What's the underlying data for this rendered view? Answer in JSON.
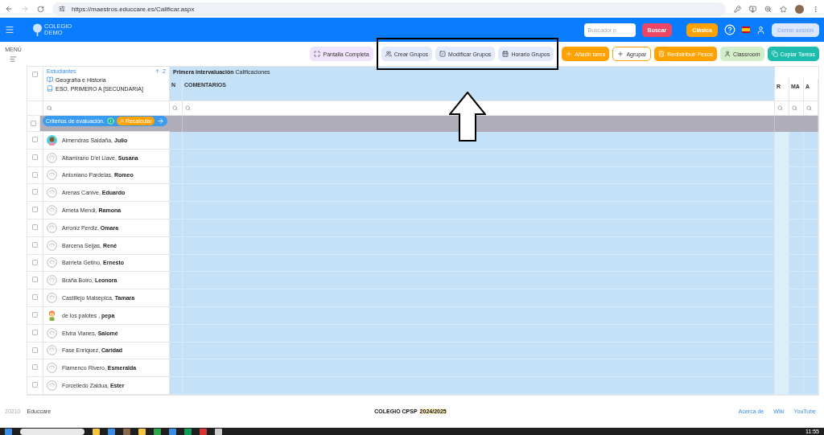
{
  "browser": {
    "url": "https://maestros.educcare.es/Calificar.aspx"
  },
  "header": {
    "logo": [
      "COLEGIO",
      "DEMO"
    ],
    "search_placeholder": "Buscador p",
    "search_button": "Buscar",
    "classic_button": "Clásica",
    "logout_button": "Cerrar sesión"
  },
  "sidebar": {
    "label": "MENÚ"
  },
  "toolbar": [
    {
      "label": "Pantalla Completa",
      "kind": "purple"
    },
    {
      "label": "Crear Grupos",
      "kind": "light"
    },
    {
      "label": "Modificar Grupos",
      "kind": "light"
    },
    {
      "label": "Horario Grupos",
      "kind": "light"
    },
    {
      "label": "Añadir tarea",
      "kind": "orange"
    },
    {
      "label": "Agrupar",
      "kind": "outline"
    },
    {
      "label": "Redistribuir Pesos",
      "kind": "orange"
    },
    {
      "label": "Classroom",
      "kind": "green"
    },
    {
      "label": "Copiar Tareas",
      "kind": "teal"
    }
  ],
  "table": {
    "select_all_checked": false,
    "students_label": "Estudiantes",
    "sort_label": "2",
    "subject": "Geografía e Historia",
    "group": "ESO. PRIMERO A [SECUNDARIA]",
    "period": "**Primera intervaluación** Calificaciones",
    "columns": [
      "N",
      "COMENTARIOS"
    ],
    "right_columns": [
      "R",
      "MA",
      "A"
    ],
    "criteria": {
      "checked": false,
      "label": "Criterios de evaluación.",
      "button": "Recalcular"
    },
    "rows": [
      {
        "surname": "Almendras Saldaña,",
        "name": "Julio",
        "kind": "boy",
        "checked": false
      },
      {
        "surname": "Altamirano D'el Llave,",
        "name": "Susana",
        "kind": "outline",
        "checked": false
      },
      {
        "surname": "Antoniano Pardelas,",
        "name": "Romeo",
        "kind": "outline",
        "checked": false
      },
      {
        "surname": "Arenas Canive,",
        "name": "Eduardo",
        "kind": "outline",
        "checked": false
      },
      {
        "surname": "Arrieta Mendi,",
        "name": "Ramona",
        "kind": "outline",
        "checked": false
      },
      {
        "surname": "Arroniz Perdiz,",
        "name": "Omara",
        "kind": "outline",
        "checked": false
      },
      {
        "surname": "Barcena Seijas,",
        "name": "René",
        "kind": "outline",
        "checked": false
      },
      {
        "surname": "Barrieta Getino,",
        "name": "Ernesto",
        "kind": "outline",
        "checked": false
      },
      {
        "surname": "Braña Boiro,",
        "name": "Leonora",
        "kind": "outline",
        "checked": false
      },
      {
        "surname": "Castillejo Malsepica,",
        "name": "Tamara",
        "kind": "outline",
        "checked": false
      },
      {
        "surname": "de los palotes ,",
        "name": "pepa",
        "kind": "girl",
        "checked": false
      },
      {
        "surname": "Elvira Vianes,",
        "name": "Salomé",
        "kind": "outline",
        "checked": false
      },
      {
        "surname": "Fase Enriquez,",
        "name": "Caridad",
        "kind": "outline",
        "checked": false
      },
      {
        "surname": "Flamenco Rivero,",
        "name": "Esmeralda",
        "kind": "outline",
        "checked": false
      },
      {
        "surname": "Forcelledo Zaldua,",
        "name": "Ester",
        "kind": "outline",
        "checked": false
      }
    ]
  },
  "footer": {
    "version": "20210",
    "brand": "Educcare",
    "school": "COLEGIO CPSP",
    "year": "2024/2025",
    "links": [
      "Acerca de",
      "Wiki",
      "YouTube"
    ]
  },
  "taskbar": {
    "time": "11:55"
  }
}
